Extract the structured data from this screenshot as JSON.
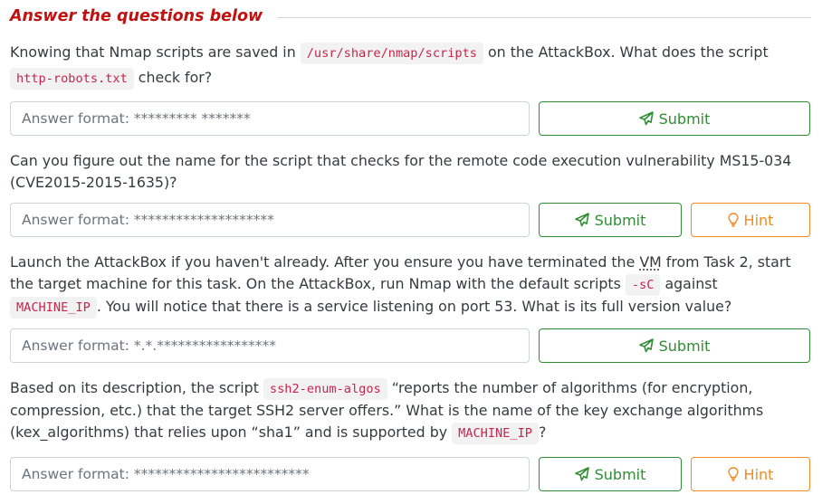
{
  "section": {
    "title": "Answer the questions below"
  },
  "questions": [
    {
      "text_a": "Knowing that Nmap scripts are saved in ",
      "code_a": "/usr/share/nmap/scripts",
      "text_b": " on the AttackBox. What does the script ",
      "code_b": "http-robots.txt",
      "text_c": " check for?",
      "placeholder": "Answer format: ********* *******",
      "submit_label": "Submit"
    },
    {
      "text_a": "Can you figure out the name for the script that checks for the remote code execution vulnerability MS15-034 (CVE2015-2015-1635)?",
      "placeholder": "Answer format: ********************",
      "submit_label": "Submit",
      "hint_label": "Hint"
    },
    {
      "text_a": "Launch the AttackBox if you haven't already. After you ensure you have terminated the ",
      "abbr": "VM",
      "text_b": " from Task 2, start the target machine for this task. On the AttackBox, run Nmap with the default scripts ",
      "code_a": "-sC",
      "text_c": " against ",
      "code_b": "MACHINE_IP",
      "text_d": ". You will notice that there is a service listening on port 53. What is its full version value?",
      "placeholder": "Answer format: *.*.*****************",
      "submit_label": "Submit"
    },
    {
      "text_a": "Based on its description, the script ",
      "code_a": "ssh2-enum-algos",
      "text_b": " “reports the number of algorithms (for encryption, compression, etc.) that the target SSH2 server offers.” What is the name of the key exchange algorithms (kex_algorithms) that relies upon “sha1” and is supported by ",
      "code_b": "MACHINE_IP",
      "text_c": "?",
      "placeholder": "Answer format: *************************",
      "submit_label": "Submit",
      "hint_label": "Hint"
    }
  ],
  "colors": {
    "title": "#c11111",
    "submit": "#2f8d32",
    "hint": "#f08a24",
    "code": "#c7254e"
  }
}
